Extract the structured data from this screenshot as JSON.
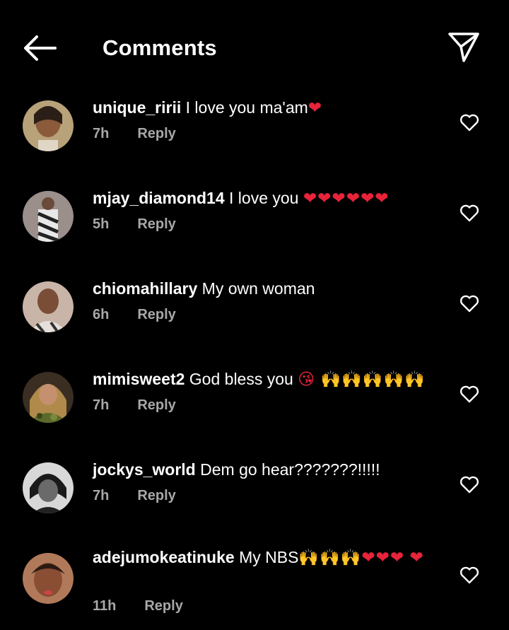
{
  "header": {
    "title": "Comments",
    "back_icon": "arrow-left-icon",
    "share_icon": "paper-plane-icon"
  },
  "colors": {
    "background": "#000000",
    "text": "#ffffff",
    "meta": "#a8a8a8",
    "heart": "#e8233a"
  },
  "comments": [
    {
      "username": "unique_ririi",
      "text": " I love you ma'am",
      "emoji": "❤",
      "time": "7h",
      "reply": "Reply"
    },
    {
      "username": "mjay_diamond14",
      "text": " I love you ",
      "emoji": "❤❤❤❤❤❤",
      "time": "5h",
      "reply": "Reply"
    },
    {
      "username": "chiomahillary",
      "text": " My own woman",
      "emoji": "",
      "time": "6h",
      "reply": "Reply"
    },
    {
      "username": "mimisweet2",
      "text": " God bless you ",
      "emoji": "😘 🙌🙌🙌🙌🙌",
      "time": "7h",
      "reply": "Reply"
    },
    {
      "username": "jockys_world",
      "text": " Dem go hear???????!!!!!",
      "emoji": "",
      "time": "7h",
      "reply": "Reply"
    },
    {
      "username": "adejumokeatinuke",
      "text": " My NBS",
      "emoji": "🙌🙌🙌❤❤❤ ❤",
      "time": "11h",
      "reply": "Reply"
    }
  ]
}
